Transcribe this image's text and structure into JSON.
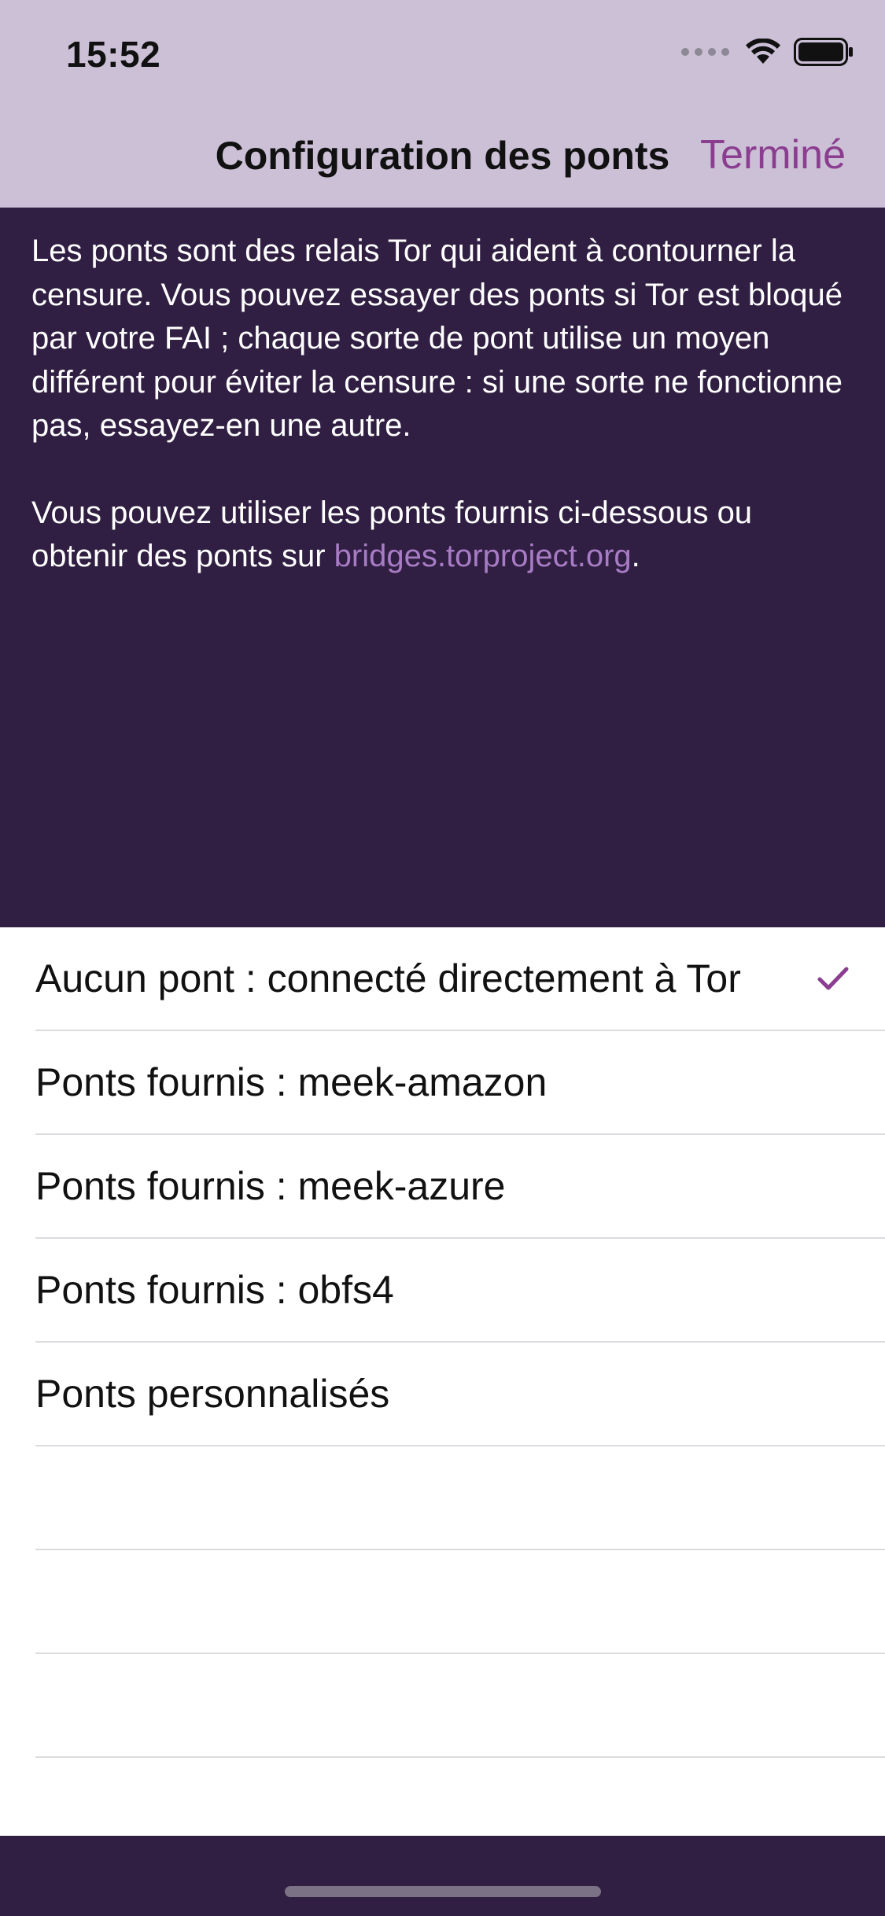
{
  "status_bar": {
    "time": "15:52",
    "icons": [
      "cellular-signal-icon",
      "wifi-icon",
      "battery-icon"
    ]
  },
  "nav": {
    "title": "Configuration des ponts",
    "done_label": "Terminé"
  },
  "info": {
    "paragraph1": "Les ponts sont des relais Tor qui aident à contourner la censure. Vous pouvez essayer des ponts si Tor est bloqué par votre FAI ; chaque sorte de pont utilise un moyen différent pour éviter la censure : si une sorte ne fonctionne pas, essayez-en une autre.",
    "paragraph2_prefix": "Vous pouvez utiliser les ponts fournis ci-dessous ou obtenir des ponts sur ",
    "link": "bridges.torproject.org",
    "paragraph2_suffix": "."
  },
  "options": [
    {
      "label": "Aucun pont : connecté directement à Tor",
      "selected": true
    },
    {
      "label": "Ponts fournis : meek-amazon",
      "selected": false
    },
    {
      "label": "Ponts fournis : meek-azure",
      "selected": false
    },
    {
      "label": "Ponts fournis : obfs4",
      "selected": false
    },
    {
      "label": "Ponts personnalisés",
      "selected": false
    }
  ],
  "colors": {
    "accent": "#8b3d8f",
    "header_background": "#301f42",
    "nav_background": "#cbc0d6",
    "link": "#a77cc4"
  }
}
